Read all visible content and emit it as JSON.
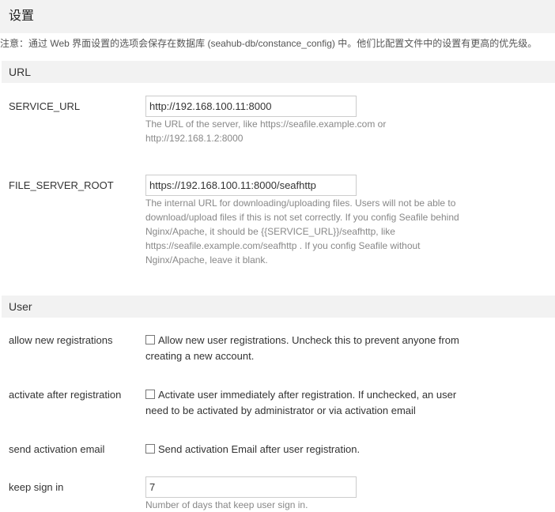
{
  "page": {
    "title": "设置",
    "notice": "注意：通过 Web 界面设置的选项会保存在数据库 (seahub-db/constance_config) 中。他们比配置文件中的设置有更高的优先级。"
  },
  "url_section": {
    "heading": "URL",
    "service_url": {
      "label": "SERVICE_URL",
      "value": "http://192.168.100.11:8000",
      "help": "The URL of the server, like https://seafile.example.com or http://192.168.1.2:8000"
    },
    "file_server_root": {
      "label": "FILE_SERVER_ROOT",
      "value": "https://192.168.100.11:8000/seafhttp",
      "help": "The internal URL for downloading/uploading files. Users will not be able to download/upload files if this is not set correctly. If you config Seafile behind Nginx/Apache, it should be {{SERVICE_URL}}/seafhttp, like https://seafile.example.com/seafhttp . If you config Seafile without Nginx/Apache, leave it blank."
    }
  },
  "user_section": {
    "heading": "User",
    "allow_registrations": {
      "label": "allow new registrations",
      "checked": false,
      "text": "Allow new user registrations. Uncheck this to prevent anyone from creating a new account."
    },
    "activate_after_registration": {
      "label": "activate after registration",
      "checked": false,
      "text": "Activate user immediately after registration. If unchecked, an user need to be activated by administrator or via activation email"
    },
    "send_activation_email": {
      "label": "send activation email",
      "checked": false,
      "text": "Send activation Email after user registration."
    },
    "keep_sign_in": {
      "label": "keep sign in",
      "value": "7",
      "help": "Number of days that keep user sign in."
    }
  }
}
